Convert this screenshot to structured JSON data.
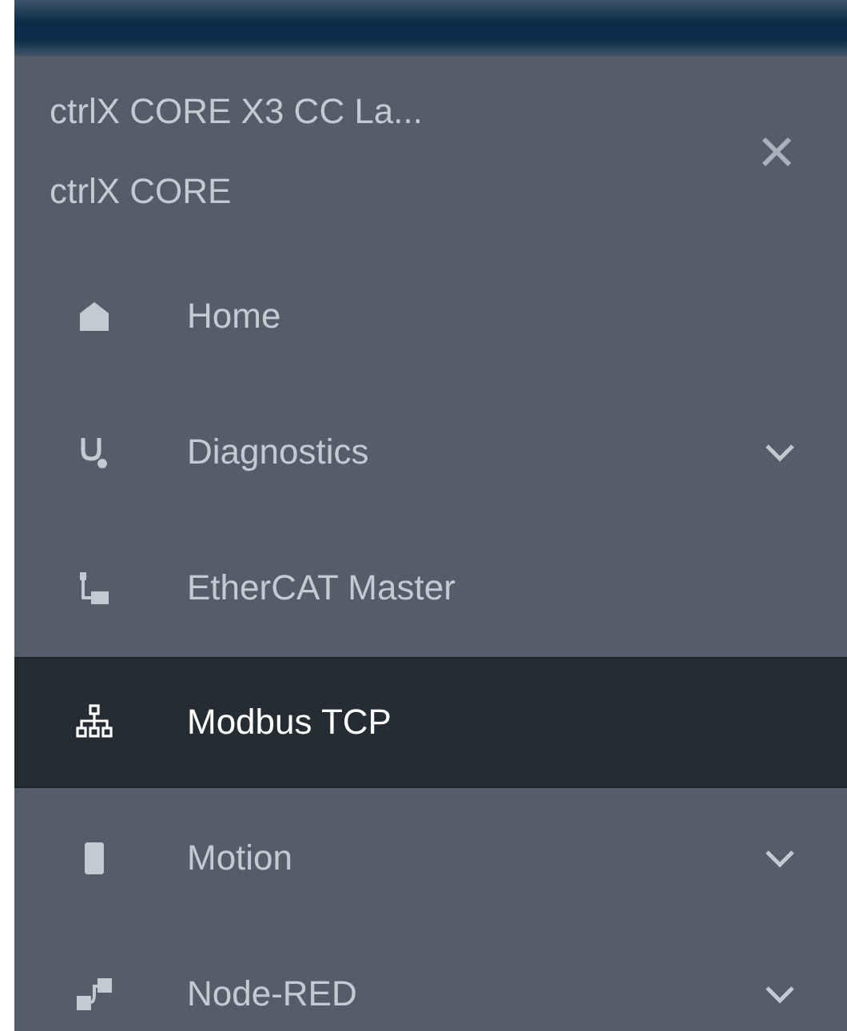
{
  "header": {
    "title": "ctrlX CORE X3 CC La...",
    "subtitle": "ctrlX CORE"
  },
  "items": [
    {
      "label": "Home",
      "kind": "home",
      "expandable": false,
      "selected": false
    },
    {
      "label": "Diagnostics",
      "kind": "diagnostics",
      "expandable": true,
      "selected": false
    },
    {
      "label": "EtherCAT Master",
      "kind": "ethercat",
      "expandable": false,
      "selected": false
    },
    {
      "label": "Modbus TCP",
      "kind": "network",
      "expandable": false,
      "selected": true
    },
    {
      "label": "Motion",
      "kind": "motion",
      "expandable": true,
      "selected": false
    },
    {
      "label": "Node-RED",
      "kind": "nodes",
      "expandable": true,
      "selected": false
    }
  ]
}
